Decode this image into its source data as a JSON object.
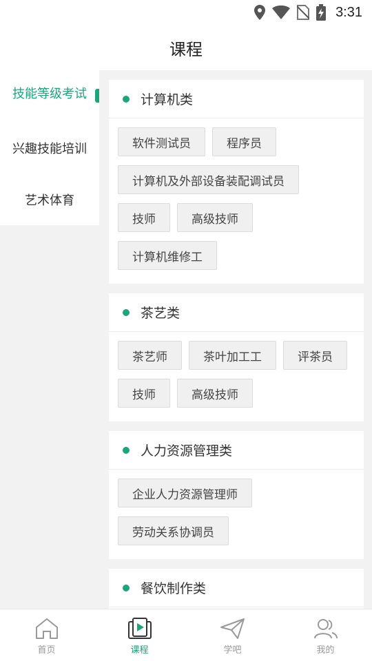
{
  "status_bar": {
    "time": "3:31",
    "icons": [
      "location-icon",
      "wifi-icon",
      "no-sim-icon",
      "battery-charging-icon"
    ]
  },
  "header": {
    "title": "课程"
  },
  "sidebar": {
    "active_index": 0,
    "items": [
      {
        "label": "技能等级考试"
      },
      {
        "label": "兴趣技能培训"
      },
      {
        "label": "艺术体育"
      }
    ]
  },
  "categories": [
    {
      "title": "计算机类",
      "tags": [
        "软件测试员",
        "程序员",
        "计算机及外部设备装配调试员",
        "技师",
        "高级技师",
        "计算机维修工"
      ]
    },
    {
      "title": "茶艺类",
      "tags": [
        "茶艺师",
        "茶叶加工工",
        "评茶员",
        "技师",
        "高级技师"
      ]
    },
    {
      "title": "人力资源管理类",
      "tags": [
        "企业人力资源管理师",
        "劳动关系协调员"
      ]
    },
    {
      "title": "餐饮制作类",
      "tags": [
        "",
        ""
      ]
    }
  ],
  "tab_bar": {
    "active_index": 1,
    "tabs": [
      {
        "label": "首页",
        "icon": "home-icon"
      },
      {
        "label": "课程",
        "icon": "course-play-icon"
      },
      {
        "label": "学吧",
        "icon": "paper-plane-icon"
      },
      {
        "label": "我的",
        "icon": "users-icon"
      }
    ]
  },
  "colors": {
    "accent": "#1aa67a",
    "background": "#f2f2f2",
    "tag_bg": "#f0f0f0",
    "inactive_tab": "#999999"
  }
}
